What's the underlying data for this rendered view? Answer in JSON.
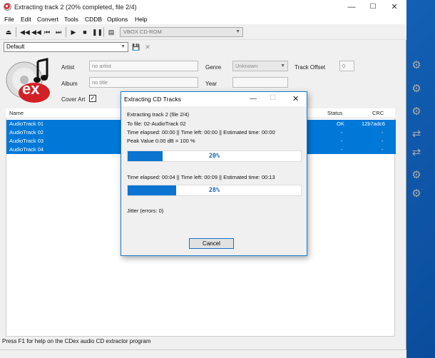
{
  "window": {
    "title": "Extracting track 2 (20% completed, file 2/4)"
  },
  "menu": [
    "File",
    "Edit",
    "Convert",
    "Tools",
    "CDDB",
    "Options",
    "Help"
  ],
  "toolbar": {
    "drive_select": "VBOX  CD-ROM",
    "profile_select": "Default"
  },
  "disc_info": {
    "artist_label": "Artist",
    "artist_value": "no artist",
    "album_label": "Album",
    "album_value": "no title",
    "cover_art_label": "Cover Art",
    "genre_label": "Genre",
    "genre_value": "Unknown",
    "year_label": "Year",
    "track_offset_label": "Track Offset",
    "track_offset_value": "0"
  },
  "list": {
    "columns": {
      "name": "Name",
      "status": "Status",
      "crc": "CRC"
    },
    "rows": [
      {
        "name": "AudioTrack 01",
        "status": "OK",
        "crc": "12b7adc6"
      },
      {
        "name": "AudioTrack 02",
        "status": "-",
        "crc": "-"
      },
      {
        "name": "AudioTrack 03",
        "status": "-",
        "crc": "-"
      },
      {
        "name": "AudioTrack 04",
        "status": "-",
        "crc": "-"
      }
    ]
  },
  "statusbar": "Press F1 for help on the CDex audio CD extractor program",
  "dialog": {
    "title": "Extracting CD Tracks",
    "line1": "Extracting track 2 (file 2/4)",
    "line2": "To file: 02-AudioTrack 02",
    "line3": "Time elapsed: 00:00 || Time left: 00:00 || Estimated time: 00:00",
    "line4": "Peak Value 0.00 dB = 100 %",
    "progress1": {
      "label": "20%",
      "fraction": 0.2
    },
    "line5": "Time elapsed: 00:04 || Time left: 00:09 || Estimated time: 00:13",
    "progress2": {
      "label": "28%",
      "fraction": 0.28
    },
    "jitter": "Jitter (errors: 0)",
    "cancel_label": "Cancel"
  },
  "colors": {
    "selection": "#0078d7",
    "progress_fill": "#0a74d0",
    "dialog_border": "#1979ca"
  }
}
